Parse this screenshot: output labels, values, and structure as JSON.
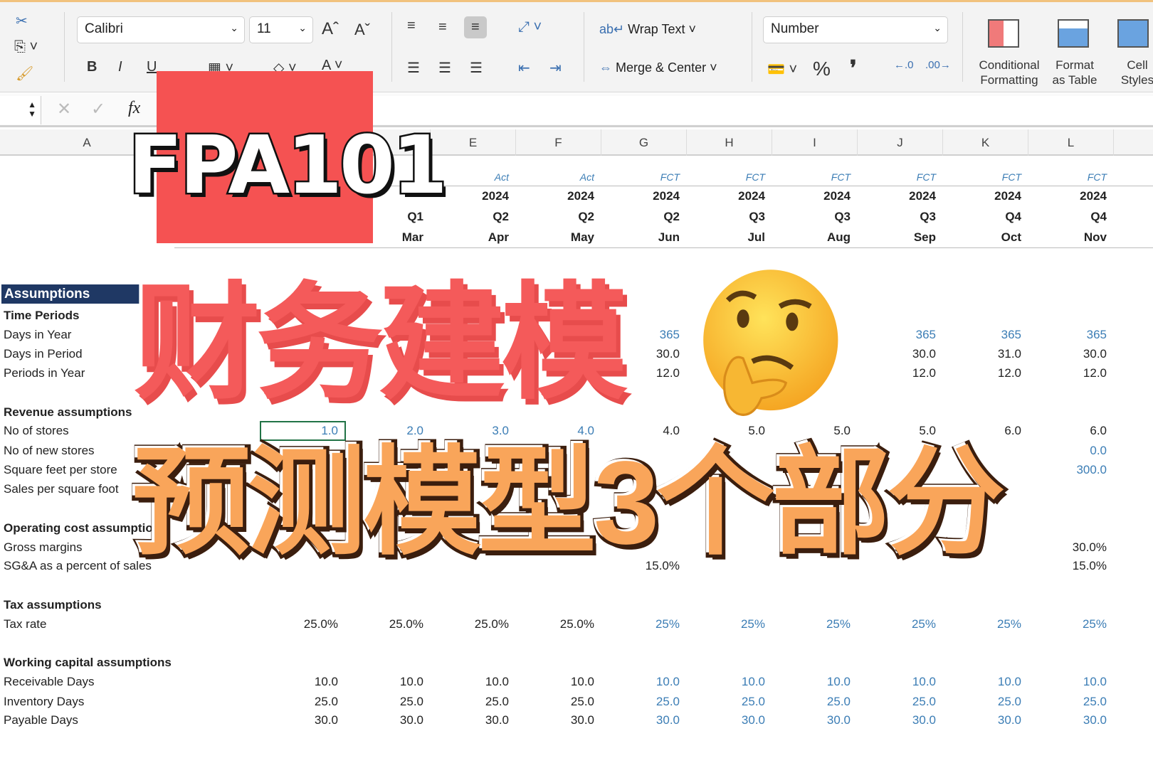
{
  "ribbon": {
    "font_name": "Calibri",
    "font_size": "11",
    "wrap_text": "Wrap Text",
    "merge_center": "Merge & Center",
    "number_format": "Number",
    "conditional_formatting": [
      "Conditional",
      "Formatting"
    ],
    "format_as_table": [
      "Format",
      "as Table"
    ],
    "cell_styles": [
      "Cell",
      "Styles"
    ],
    "bold": "B",
    "italic": "I",
    "underline": "U",
    "percent": "%",
    "comma": "❜",
    "fx": "fx"
  },
  "columns": [
    "A",
    "",
    "",
    "",
    "E",
    "F",
    "G",
    "H",
    "I",
    "J",
    "K",
    "L"
  ],
  "header_rows": {
    "status": [
      "",
      "",
      "Act",
      "Act",
      "FCT",
      "FCT",
      "FCT",
      "FCT",
      "FCT",
      "FCT"
    ],
    "year": [
      "",
      "",
      "2024",
      "2024",
      "2024",
      "2024",
      "2024",
      "2024",
      "2024",
      "2024"
    ],
    "quarter": [
      "",
      "Q1",
      "Q2",
      "Q2",
      "Q2",
      "Q3",
      "Q3",
      "Q3",
      "Q4",
      "Q4"
    ],
    "month": [
      "",
      "Mar",
      "Apr",
      "May",
      "Jun",
      "Jul",
      "Aug",
      "Sep",
      "Oct",
      "Nov"
    ]
  },
  "section_title": "Assumptions",
  "rows": [
    {
      "label": "Time Periods",
      "bold": true,
      "values": []
    },
    {
      "label": "Days in Year",
      "values": [
        "",
        "",
        "",
        "",
        "365",
        "",
        "",
        "365",
        "365",
        "365"
      ],
      "blue": [
        4,
        7,
        8,
        9
      ]
    },
    {
      "label": "Days in Period",
      "values": [
        "",
        "",
        "",
        "",
        "30.0",
        "",
        "",
        "30.0",
        "31.0",
        "30.0"
      ]
    },
    {
      "label": "Periods in Year",
      "values": [
        "",
        "",
        "",
        "",
        "12.0",
        "",
        "",
        "12.0",
        "12.0",
        "12.0"
      ]
    },
    {
      "label": "",
      "values": []
    },
    {
      "label": "Revenue assumptions",
      "bold": true,
      "values": []
    },
    {
      "label": "No of stores",
      "values": [
        "1.0",
        "2.0",
        "3.0",
        "4.0",
        "4.0",
        "5.0",
        "5.0",
        "5.0",
        "6.0",
        "6.0"
      ],
      "blue": [
        0,
        1,
        2,
        3
      ]
    },
    {
      "label": "No of new stores",
      "values": [
        "",
        "",
        "",
        "",
        "",
        "",
        "",
        "",
        "",
        "0.0"
      ],
      "blue": [
        9
      ]
    },
    {
      "label": "Square feet per store",
      "values": [
        "",
        "",
        "",
        "",
        "",
        "",
        "",
        "",
        "",
        "300.0"
      ],
      "blue": [
        9
      ]
    },
    {
      "label": "Sales per square foot",
      "values": []
    },
    {
      "label": "",
      "values": []
    },
    {
      "label": "Operating cost assumptions",
      "bold": true,
      "values": []
    },
    {
      "label": "Gross margins",
      "values": [
        "",
        "",
        "",
        "",
        "",
        "",
        "",
        "",
        "",
        "30.0%"
      ]
    },
    {
      "label": "SG&A as a percent of sales",
      "values": [
        "",
        "",
        "",
        "",
        "15.0%",
        "",
        "",
        "",
        "",
        "15.0%"
      ]
    },
    {
      "label": "",
      "values": []
    },
    {
      "label": "Tax assumptions",
      "bold": true,
      "values": []
    },
    {
      "label": "Tax rate",
      "values": [
        "25.0%",
        "25.0%",
        "25.0%",
        "25.0%",
        "25%",
        "25%",
        "25%",
        "25%",
        "25%",
        "25%"
      ],
      "blue": [
        4,
        5,
        6,
        7,
        8,
        9
      ]
    },
    {
      "label": "",
      "values": []
    },
    {
      "label": "Working capital assumptions",
      "bold": true,
      "values": []
    },
    {
      "label": "Receivable Days",
      "values": [
        "10.0",
        "10.0",
        "10.0",
        "10.0",
        "10.0",
        "10.0",
        "10.0",
        "10.0",
        "10.0",
        "10.0"
      ],
      "blue": [
        4,
        5,
        6,
        7,
        8,
        9
      ]
    },
    {
      "label": "Inventory Days",
      "values": [
        "25.0",
        "25.0",
        "25.0",
        "25.0",
        "25.0",
        "25.0",
        "25.0",
        "25.0",
        "25.0",
        "25.0"
      ],
      "blue": [
        4,
        5,
        6,
        7,
        8,
        9
      ]
    },
    {
      "label": "Payable Days",
      "values": [
        "30.0",
        "30.0",
        "30.0",
        "30.0",
        "30.0",
        "30.0",
        "30.0",
        "30.0",
        "30.0",
        "30.0"
      ],
      "blue": [
        4,
        5,
        6,
        7,
        8,
        9
      ]
    }
  ],
  "overlay": {
    "badge": "FPA101",
    "title": "财务建模",
    "subtitle": "预测模型3个部分",
    "emoji": "thinking-face"
  },
  "colors": {
    "input_blue": "#3b7db5",
    "header_navy": "#1f3864",
    "badge_red": "#f55252",
    "title_red": "#f45a5a",
    "subtitle_orange": "#f9a55a"
  }
}
